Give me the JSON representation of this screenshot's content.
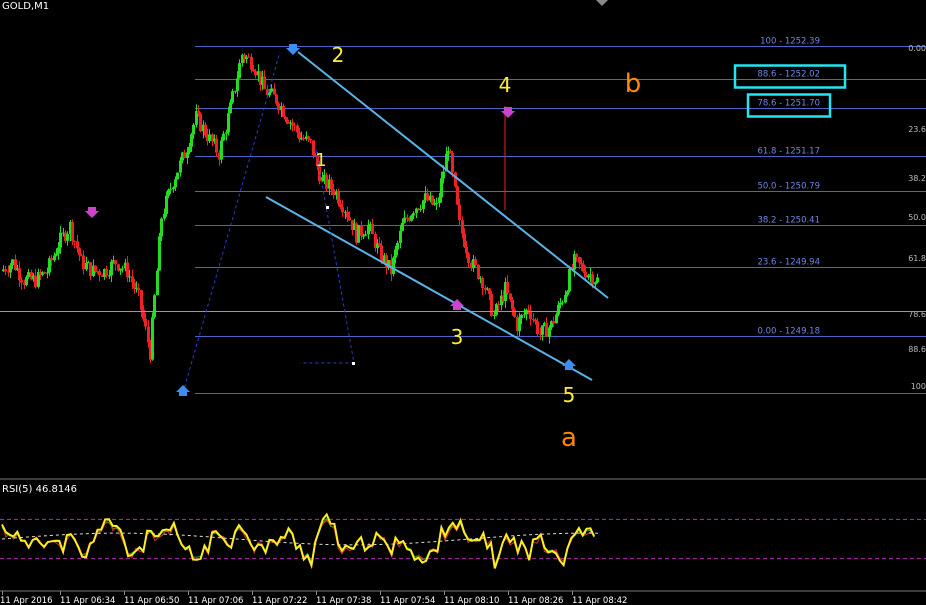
{
  "symbol": "GOLD,M1",
  "indicator_label": "RSI(5) 46.8146",
  "chart_data": {
    "type": "line",
    "title": "GOLD,M1",
    "ylim": [
      1248.55,
      1252.75
    ],
    "fib_levels": [
      {
        "label": "100 - 1252.39",
        "price": 1252.39
      },
      {
        "label": "88.6 - 1252.02",
        "price": 1252.02,
        "boxed": true
      },
      {
        "label": "78.6 - 1251.70",
        "price": 1251.7,
        "boxed": true
      },
      {
        "label": "61.8 - 1251.17",
        "price": 1251.17
      },
      {
        "label": "50.0 - 1250.79",
        "price": 1250.79
      },
      {
        "label": "38.2 - 1250.41",
        "price": 1250.41
      },
      {
        "label": "23.6 - 1249.94",
        "price": 1249.94
      },
      {
        "label": "0.00 - 1249.18",
        "price": 1249.18
      }
    ],
    "right_labels": [
      "0.00",
      "23.6",
      "38.2",
      "50.0",
      "61.8",
      "78.6",
      "88.6",
      "100"
    ],
    "wave_labels": [
      "2",
      "1",
      "4",
      "3",
      "5",
      "b",
      "a"
    ],
    "x_labels": [
      "11 Apr 2016",
      "11 Apr 06:34",
      "11 Apr 06:50",
      "11 Apr 07:06",
      "11 Apr 07:22",
      "11 Apr 07:38",
      "11 Apr 07:54",
      "11 Apr 08:10",
      "11 Apr 08:26",
      "11 Apr 08:42"
    ],
    "price_path": [
      1249.9,
      1250.0,
      1249.8,
      1249.8,
      1249.9,
      1250.2,
      1250.4,
      1250.0,
      1249.9,
      1249.9,
      1250.0,
      1249.9,
      1249.6,
      1249.0,
      1250.5,
      1250.9,
      1251.2,
      1251.6,
      1251.4,
      1251.2,
      1251.7,
      1252.3,
      1252.2,
      1251.9,
      1251.8,
      1251.6,
      1251.4,
      1251.3,
      1250.9,
      1250.8,
      1250.6,
      1250.3,
      1250.4,
      1250.1,
      1249.9,
      1250.4,
      1250.6,
      1250.7,
      1250.6,
      1251.3,
      1250.4,
      1250.0,
      1249.8,
      1249.4,
      1249.7,
      1249.3,
      1249.5,
      1249.2,
      1249.3,
      1249.6,
      1250.0,
      1249.9,
      1249.8
    ],
    "rsi_path": [
      62,
      58,
      40,
      55,
      48,
      42,
      50,
      30,
      45,
      75,
      60,
      35,
      40,
      55,
      50,
      60,
      38,
      28,
      45,
      55,
      50,
      65,
      45,
      38,
      50,
      55,
      40,
      30,
      72,
      58,
      35,
      40,
      50,
      48,
      38,
      55,
      30,
      25,
      45,
      70,
      62,
      40,
      55,
      28,
      50,
      45,
      35,
      55,
      40,
      30,
      62,
      58,
      45
    ],
    "rsi_levels": [
      70,
      30
    ],
    "rsi_ylim": [
      0,
      100
    ]
  }
}
